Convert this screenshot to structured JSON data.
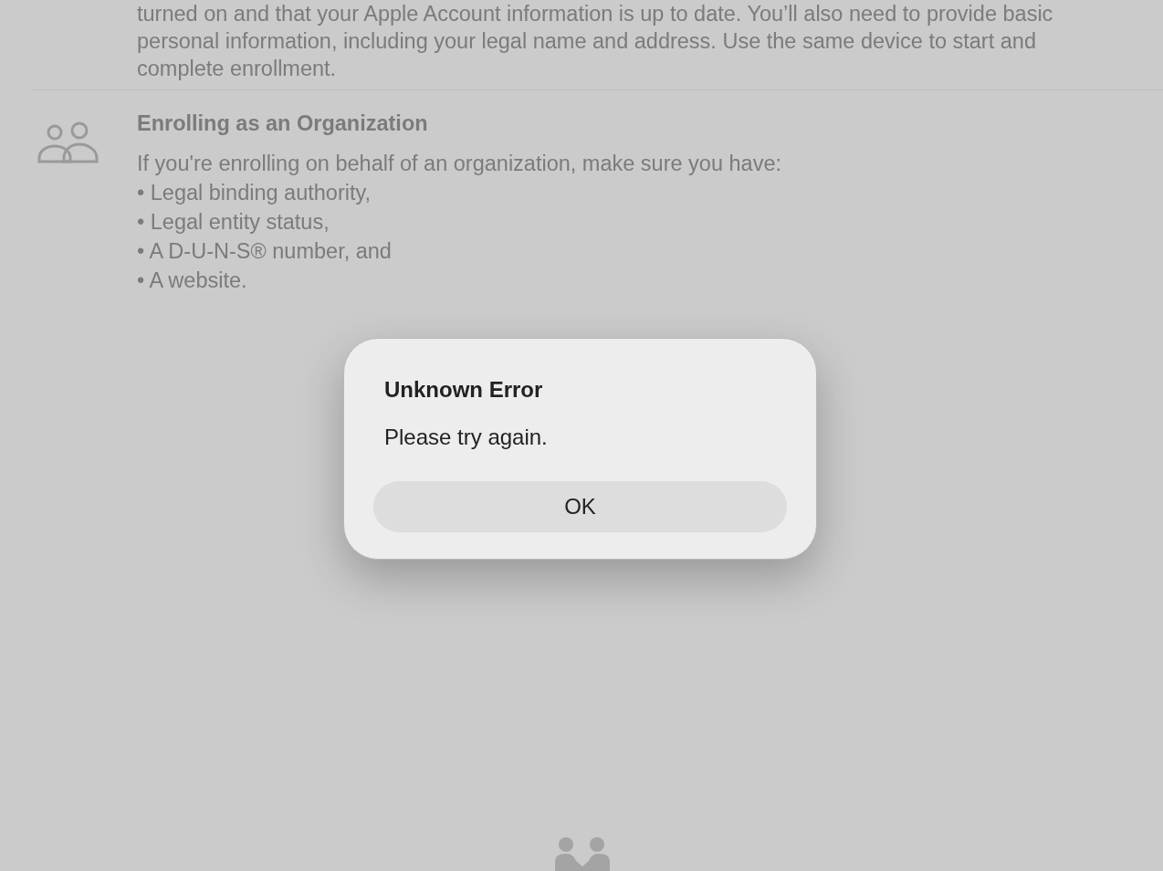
{
  "page": {
    "previous_text": "turned on and that your Apple Account information is up to date. You’ll also need to provide basic personal information, including your legal name and address. Use the same device to start and complete enrollment.",
    "section": {
      "title": "Enrolling as an Organization",
      "intro": "If you're enrolling on behalf of an organization, make sure you have:",
      "bullets": [
        "• Legal binding authority,",
        "• Legal entity status,",
        "• A D-U-N-S® number, and",
        "• A website."
      ]
    }
  },
  "dialog": {
    "title": "Unknown Error",
    "message": "Please try again.",
    "buttons": [
      "OK"
    ]
  }
}
